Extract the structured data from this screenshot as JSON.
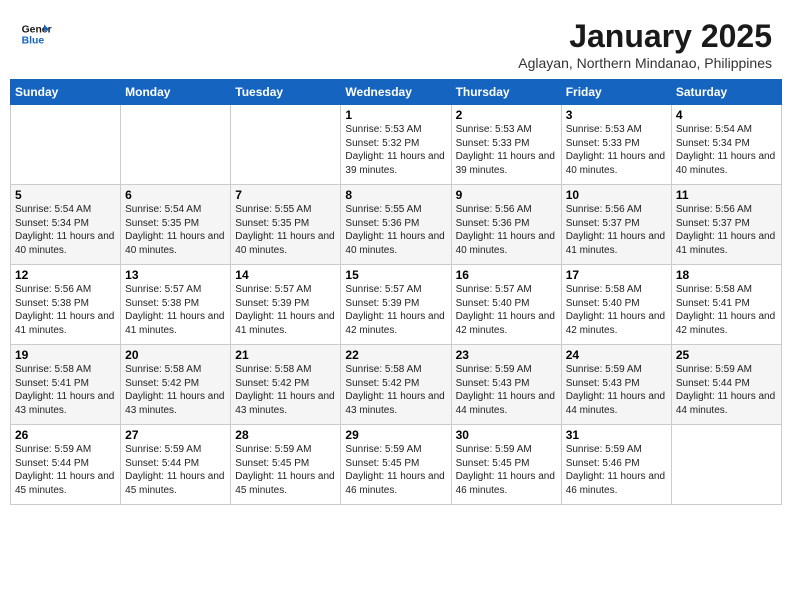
{
  "header": {
    "logo_line1": "General",
    "logo_line2": "Blue",
    "title": "January 2025",
    "subtitle": "Aglayan, Northern Mindanao, Philippines"
  },
  "weekdays": [
    "Sunday",
    "Monday",
    "Tuesday",
    "Wednesday",
    "Thursday",
    "Friday",
    "Saturday"
  ],
  "weeks": [
    [
      {
        "day": null,
        "sunrise": null,
        "sunset": null,
        "daylight": null
      },
      {
        "day": null,
        "sunrise": null,
        "sunset": null,
        "daylight": null
      },
      {
        "day": null,
        "sunrise": null,
        "sunset": null,
        "daylight": null
      },
      {
        "day": "1",
        "sunrise": "Sunrise: 5:53 AM",
        "sunset": "Sunset: 5:32 PM",
        "daylight": "Daylight: 11 hours and 39 minutes."
      },
      {
        "day": "2",
        "sunrise": "Sunrise: 5:53 AM",
        "sunset": "Sunset: 5:33 PM",
        "daylight": "Daylight: 11 hours and 39 minutes."
      },
      {
        "day": "3",
        "sunrise": "Sunrise: 5:53 AM",
        "sunset": "Sunset: 5:33 PM",
        "daylight": "Daylight: 11 hours and 40 minutes."
      },
      {
        "day": "4",
        "sunrise": "Sunrise: 5:54 AM",
        "sunset": "Sunset: 5:34 PM",
        "daylight": "Daylight: 11 hours and 40 minutes."
      }
    ],
    [
      {
        "day": "5",
        "sunrise": "Sunrise: 5:54 AM",
        "sunset": "Sunset: 5:34 PM",
        "daylight": "Daylight: 11 hours and 40 minutes."
      },
      {
        "day": "6",
        "sunrise": "Sunrise: 5:54 AM",
        "sunset": "Sunset: 5:35 PM",
        "daylight": "Daylight: 11 hours and 40 minutes."
      },
      {
        "day": "7",
        "sunrise": "Sunrise: 5:55 AM",
        "sunset": "Sunset: 5:35 PM",
        "daylight": "Daylight: 11 hours and 40 minutes."
      },
      {
        "day": "8",
        "sunrise": "Sunrise: 5:55 AM",
        "sunset": "Sunset: 5:36 PM",
        "daylight": "Daylight: 11 hours and 40 minutes."
      },
      {
        "day": "9",
        "sunrise": "Sunrise: 5:56 AM",
        "sunset": "Sunset: 5:36 PM",
        "daylight": "Daylight: 11 hours and 40 minutes."
      },
      {
        "day": "10",
        "sunrise": "Sunrise: 5:56 AM",
        "sunset": "Sunset: 5:37 PM",
        "daylight": "Daylight: 11 hours and 41 minutes."
      },
      {
        "day": "11",
        "sunrise": "Sunrise: 5:56 AM",
        "sunset": "Sunset: 5:37 PM",
        "daylight": "Daylight: 11 hours and 41 minutes."
      }
    ],
    [
      {
        "day": "12",
        "sunrise": "Sunrise: 5:56 AM",
        "sunset": "Sunset: 5:38 PM",
        "daylight": "Daylight: 11 hours and 41 minutes."
      },
      {
        "day": "13",
        "sunrise": "Sunrise: 5:57 AM",
        "sunset": "Sunset: 5:38 PM",
        "daylight": "Daylight: 11 hours and 41 minutes."
      },
      {
        "day": "14",
        "sunrise": "Sunrise: 5:57 AM",
        "sunset": "Sunset: 5:39 PM",
        "daylight": "Daylight: 11 hours and 41 minutes."
      },
      {
        "day": "15",
        "sunrise": "Sunrise: 5:57 AM",
        "sunset": "Sunset: 5:39 PM",
        "daylight": "Daylight: 11 hours and 42 minutes."
      },
      {
        "day": "16",
        "sunrise": "Sunrise: 5:57 AM",
        "sunset": "Sunset: 5:40 PM",
        "daylight": "Daylight: 11 hours and 42 minutes."
      },
      {
        "day": "17",
        "sunrise": "Sunrise: 5:58 AM",
        "sunset": "Sunset: 5:40 PM",
        "daylight": "Daylight: 11 hours and 42 minutes."
      },
      {
        "day": "18",
        "sunrise": "Sunrise: 5:58 AM",
        "sunset": "Sunset: 5:41 PM",
        "daylight": "Daylight: 11 hours and 42 minutes."
      }
    ],
    [
      {
        "day": "19",
        "sunrise": "Sunrise: 5:58 AM",
        "sunset": "Sunset: 5:41 PM",
        "daylight": "Daylight: 11 hours and 43 minutes."
      },
      {
        "day": "20",
        "sunrise": "Sunrise: 5:58 AM",
        "sunset": "Sunset: 5:42 PM",
        "daylight": "Daylight: 11 hours and 43 minutes."
      },
      {
        "day": "21",
        "sunrise": "Sunrise: 5:58 AM",
        "sunset": "Sunset: 5:42 PM",
        "daylight": "Daylight: 11 hours and 43 minutes."
      },
      {
        "day": "22",
        "sunrise": "Sunrise: 5:58 AM",
        "sunset": "Sunset: 5:42 PM",
        "daylight": "Daylight: 11 hours and 43 minutes."
      },
      {
        "day": "23",
        "sunrise": "Sunrise: 5:59 AM",
        "sunset": "Sunset: 5:43 PM",
        "daylight": "Daylight: 11 hours and 44 minutes."
      },
      {
        "day": "24",
        "sunrise": "Sunrise: 5:59 AM",
        "sunset": "Sunset: 5:43 PM",
        "daylight": "Daylight: 11 hours and 44 minutes."
      },
      {
        "day": "25",
        "sunrise": "Sunrise: 5:59 AM",
        "sunset": "Sunset: 5:44 PM",
        "daylight": "Daylight: 11 hours and 44 minutes."
      }
    ],
    [
      {
        "day": "26",
        "sunrise": "Sunrise: 5:59 AM",
        "sunset": "Sunset: 5:44 PM",
        "daylight": "Daylight: 11 hours and 45 minutes."
      },
      {
        "day": "27",
        "sunrise": "Sunrise: 5:59 AM",
        "sunset": "Sunset: 5:44 PM",
        "daylight": "Daylight: 11 hours and 45 minutes."
      },
      {
        "day": "28",
        "sunrise": "Sunrise: 5:59 AM",
        "sunset": "Sunset: 5:45 PM",
        "daylight": "Daylight: 11 hours and 45 minutes."
      },
      {
        "day": "29",
        "sunrise": "Sunrise: 5:59 AM",
        "sunset": "Sunset: 5:45 PM",
        "daylight": "Daylight: 11 hours and 46 minutes."
      },
      {
        "day": "30",
        "sunrise": "Sunrise: 5:59 AM",
        "sunset": "Sunset: 5:45 PM",
        "daylight": "Daylight: 11 hours and 46 minutes."
      },
      {
        "day": "31",
        "sunrise": "Sunrise: 5:59 AM",
        "sunset": "Sunset: 5:46 PM",
        "daylight": "Daylight: 11 hours and 46 minutes."
      },
      {
        "day": null,
        "sunrise": null,
        "sunset": null,
        "daylight": null
      }
    ]
  ]
}
